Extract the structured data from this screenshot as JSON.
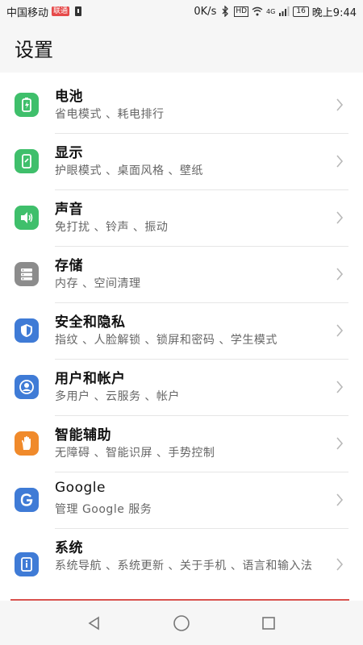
{
  "status_bar": {
    "carrier": "中国移动",
    "carrier_badge": "联通",
    "net_speed": "0K/s",
    "hd_label": "HD",
    "signal_label": "4G",
    "battery": "16",
    "time": "晚上9:44"
  },
  "header": {
    "title": "设置"
  },
  "items": [
    {
      "title": "电池",
      "subtitle": "省电模式 、耗电排行",
      "icon": "battery-icon",
      "color": "#3fbf6b"
    },
    {
      "title": "显示",
      "subtitle": "护眼模式 、桌面风格 、壁纸",
      "icon": "display-icon",
      "color": "#3fbf6b"
    },
    {
      "title": "声音",
      "subtitle": "免打扰 、铃声 、振动",
      "icon": "sound-icon",
      "color": "#3fbf6b"
    },
    {
      "title": "存储",
      "subtitle": "内存 、空间清理",
      "icon": "storage-icon",
      "color": "#8c8c8c"
    },
    {
      "title": "安全和隐私",
      "subtitle": "指纹 、人脸解锁 、锁屏和密码 、学生模式",
      "icon": "shield-icon",
      "color": "#3f7bd6"
    },
    {
      "title": "用户和帐户",
      "subtitle": "多用户 、云服务 、帐户",
      "icon": "user-icon",
      "color": "#3f7bd6"
    },
    {
      "title": "智能辅助",
      "subtitle": "无障碍 、智能识屏 、手势控制",
      "icon": "hand-icon",
      "color": "#f08a2b"
    },
    {
      "title": "Google",
      "subtitle": "管理 Google 服务",
      "icon": "google-icon",
      "color": "#3f7bd6"
    },
    {
      "title": "系统",
      "subtitle": "系统导航 、系统更新 、关于手机 、语言和输入法",
      "icon": "system-icon",
      "color": "#3f7bd6"
    }
  ]
}
